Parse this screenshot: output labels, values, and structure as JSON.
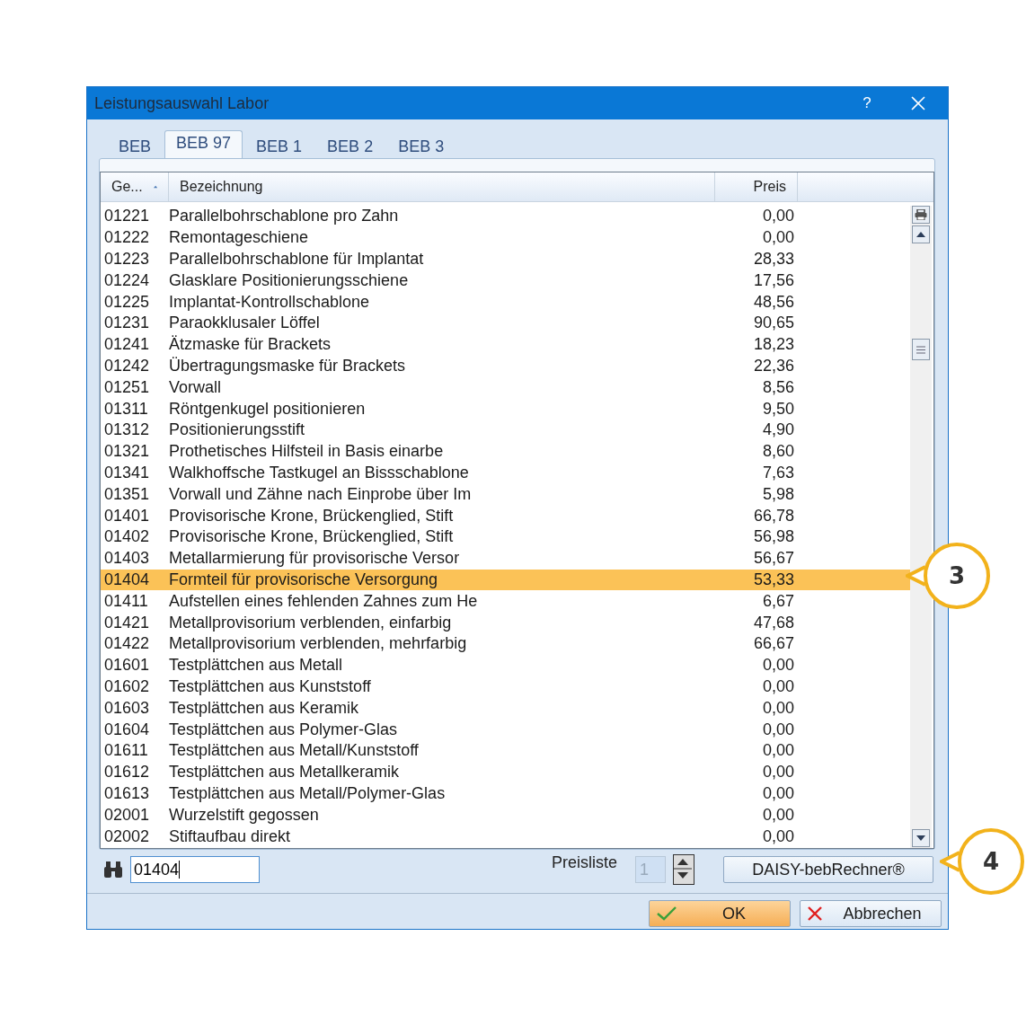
{
  "window": {
    "title": "Leistungsauswahl Labor",
    "help": "?"
  },
  "tabs": [
    {
      "label": "BEB",
      "selected": false
    },
    {
      "label": "BEB 97",
      "selected": true
    },
    {
      "label": "BEB 1",
      "selected": false
    },
    {
      "label": "BEB 2",
      "selected": false
    },
    {
      "label": "BEB 3",
      "selected": false
    }
  ],
  "table": {
    "columns": [
      {
        "label": "Ge...",
        "sorted": true
      },
      {
        "label": "Bezeichnung",
        "sorted": false
      },
      {
        "label": "Preis",
        "sorted": false
      }
    ],
    "rows": [
      {
        "code": "01221",
        "name": "Parallelbohrschablone pro Zahn",
        "price": "0,00",
        "selected": false
      },
      {
        "code": "01222",
        "name": "Remontageschiene",
        "price": "0,00",
        "selected": false
      },
      {
        "code": "01223",
        "name": "Parallelbohrschablone für Implantat",
        "price": "28,33",
        "selected": false
      },
      {
        "code": "01224",
        "name": "Glasklare Positionierungsschiene",
        "price": "17,56",
        "selected": false
      },
      {
        "code": "01225",
        "name": "Implantat-Kontrollschablone",
        "price": "48,56",
        "selected": false
      },
      {
        "code": "01231",
        "name": "Paraokklusaler Löffel",
        "price": "90,65",
        "selected": false
      },
      {
        "code": "01241",
        "name": "Ätzmaske für Brackets",
        "price": "18,23",
        "selected": false
      },
      {
        "code": "01242",
        "name": "Übertragungsmaske für Brackets",
        "price": "22,36",
        "selected": false
      },
      {
        "code": "01251",
        "name": "Vorwall",
        "price": "8,56",
        "selected": false
      },
      {
        "code": "01311",
        "name": "Röntgenkugel  positionieren",
        "price": "9,50",
        "selected": false
      },
      {
        "code": "01312",
        "name": "Positionierungsstift",
        "price": "4,90",
        "selected": false
      },
      {
        "code": "01321",
        "name": "Prothetisches Hilfsteil in Basis einarbe",
        "price": "8,60",
        "selected": false
      },
      {
        "code": "01341",
        "name": "Walkhoffsche Tastkugel an Bissschablone",
        "price": "7,63",
        "selected": false
      },
      {
        "code": "01351",
        "name": "Vorwall und  Zähne nach Einprobe über Im",
        "price": "5,98",
        "selected": false
      },
      {
        "code": "01401",
        "name": "Provisorische Krone, Brückenglied, Stift",
        "price": "66,78",
        "selected": false
      },
      {
        "code": "01402",
        "name": "Provisorische Krone, Brückenglied, Stift",
        "price": "56,98",
        "selected": false
      },
      {
        "code": "01403",
        "name": "Metallarmierung für provisorische Versor",
        "price": "56,67",
        "selected": false
      },
      {
        "code": "01404",
        "name": "Formteil für provisorische Versorgung",
        "price": "53,33",
        "selected": true
      },
      {
        "code": "01411",
        "name": "Aufstellen eines fehlenden Zahnes zum He",
        "price": "6,67",
        "selected": false
      },
      {
        "code": "01421",
        "name": "Metallprovisorium verblenden, einfarbig",
        "price": "47,68",
        "selected": false
      },
      {
        "code": "01422",
        "name": "Metallprovisorium verblenden, mehrfarbig",
        "price": "66,67",
        "selected": false
      },
      {
        "code": "01601",
        "name": "Testplättchen aus Metall",
        "price": "0,00",
        "selected": false
      },
      {
        "code": "01602",
        "name": "Testplättchen aus Kunststoff",
        "price": "0,00",
        "selected": false
      },
      {
        "code": "01603",
        "name": "Testplättchen aus Keramik",
        "price": "0,00",
        "selected": false
      },
      {
        "code": "01604",
        "name": "Testplättchen aus Polymer-Glas",
        "price": "0,00",
        "selected": false
      },
      {
        "code": "01611",
        "name": "Testplättchen aus Metall/Kunststoff",
        "price": "0,00",
        "selected": false
      },
      {
        "code": "01612",
        "name": "Testplättchen aus Metallkeramik",
        "price": "0,00",
        "selected": false
      },
      {
        "code": "01613",
        "name": "Testplättchen aus Metall/Polymer-Glas",
        "price": "0,00",
        "selected": false
      },
      {
        "code": "02001",
        "name": "Wurzelstift gegossen",
        "price": "0,00",
        "selected": false
      },
      {
        "code": "02002",
        "name": "Stiftaufbau direkt",
        "price": "0,00",
        "selected": false
      }
    ]
  },
  "search": {
    "value": "01404"
  },
  "pricelist": {
    "label": "Preisliste",
    "value": "1",
    "disabled": true
  },
  "calculator_button": "DAISY-bebRechner®",
  "buttons": [
    {
      "kind": "ok",
      "label": "OK"
    },
    {
      "kind": "cancel",
      "label": "Abbrechen"
    }
  ],
  "callouts": [
    {
      "label": "3"
    },
    {
      "label": "4"
    }
  ]
}
